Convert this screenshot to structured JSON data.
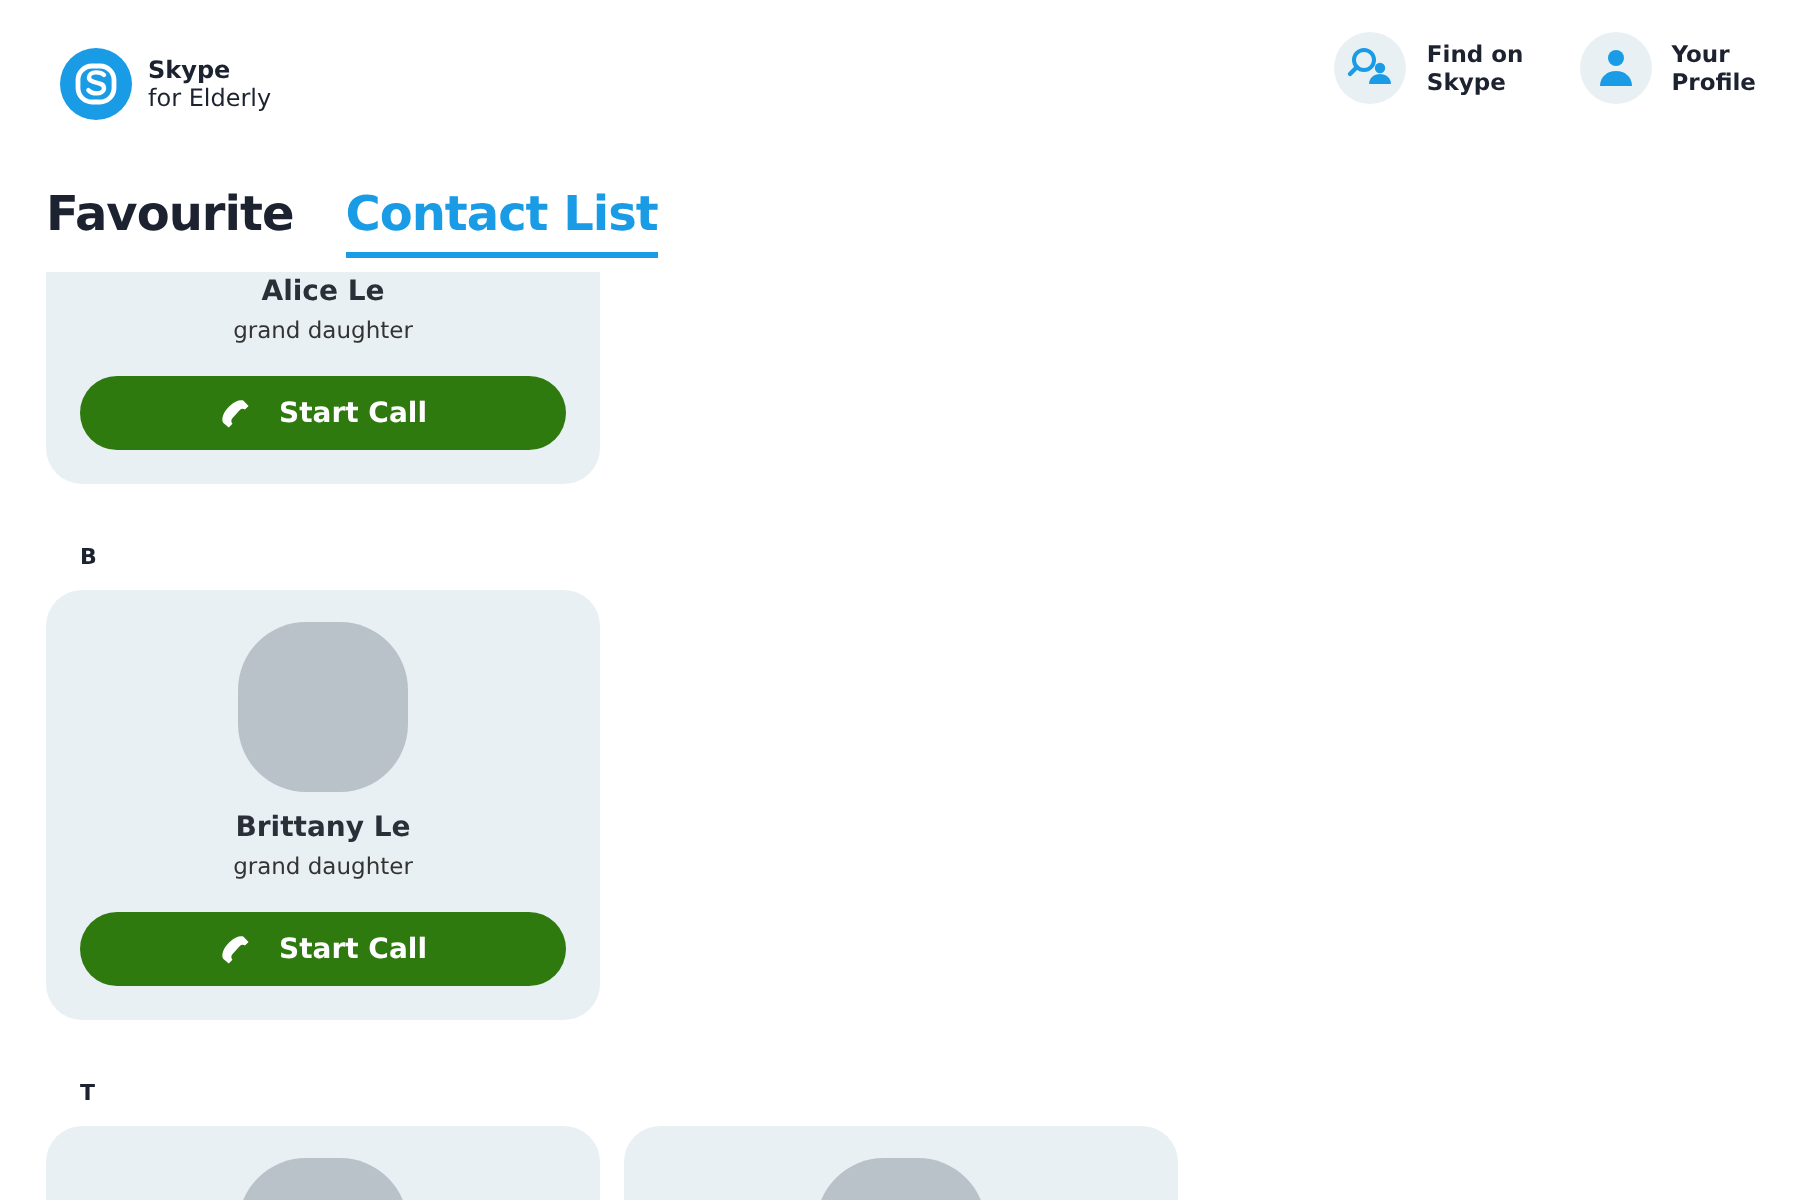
{
  "brand": {
    "name": "Skype",
    "tagline": "for Elderly"
  },
  "header_actions": [
    {
      "kind": "search",
      "label": "Find on\nSkype"
    },
    {
      "kind": "profile",
      "label": "Your\nProfile"
    }
  ],
  "tabs": [
    {
      "label": "Favourite",
      "selected": false
    },
    {
      "label": "Contact List",
      "selected": true
    }
  ],
  "sections": [
    {
      "contacts": [
        {
          "name": "Alice Le",
          "relation": "grand daughter",
          "photo": false,
          "button": "Start Call"
        }
      ]
    },
    {
      "letter": "B",
      "contacts": [
        {
          "name": "Brittany Le",
          "relation": "grand daughter",
          "photo": true,
          "button": "Start Call"
        }
      ]
    },
    {
      "letter": "T",
      "contacts": [
        {
          "photo": true
        },
        {
          "photo": true
        }
      ]
    }
  ]
}
